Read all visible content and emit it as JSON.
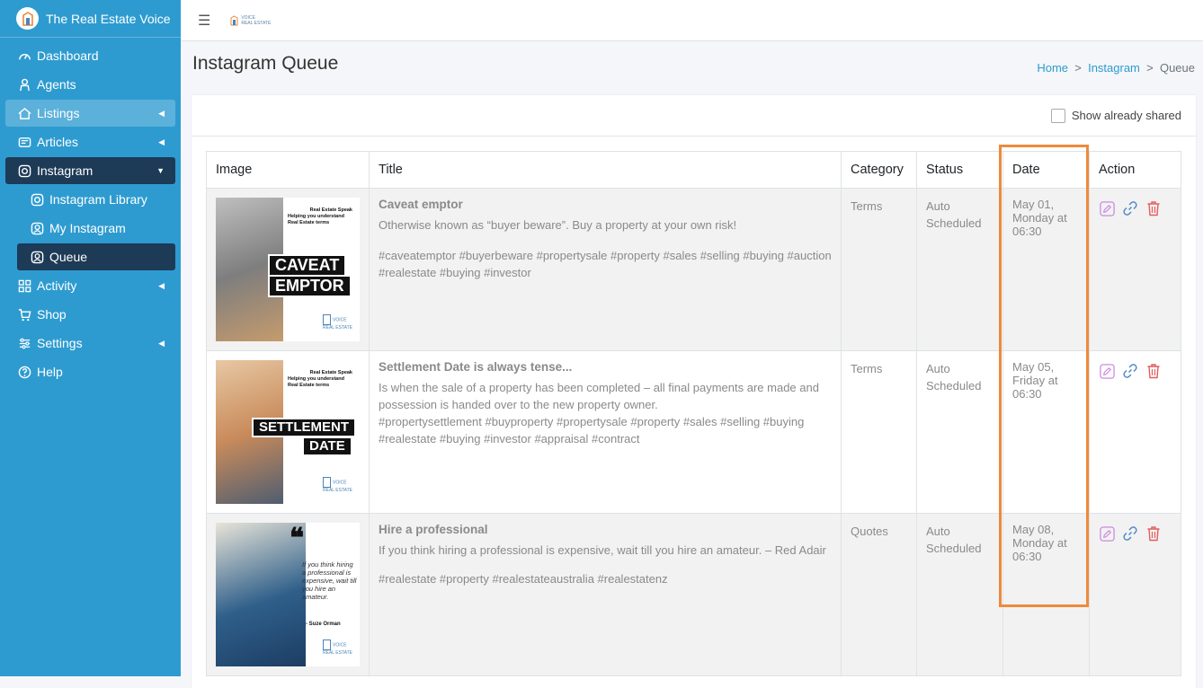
{
  "app": {
    "title": "The Real Estate Voice"
  },
  "sidebar": {
    "items": [
      {
        "label": "Dashboard",
        "icon": "dashboard-icon"
      },
      {
        "label": "Agents",
        "icon": "agents-icon"
      },
      {
        "label": "Listings",
        "icon": "listings-icon"
      },
      {
        "label": "Articles",
        "icon": "articles-icon"
      },
      {
        "label": "Instagram",
        "icon": "instagram-icon"
      },
      {
        "label": "Instagram Library",
        "icon": "instagram-icon"
      },
      {
        "label": "My Instagram",
        "icon": "my-instagram-icon"
      },
      {
        "label": "Queue",
        "icon": "queue-icon"
      },
      {
        "label": "Activity",
        "icon": "activity-icon"
      },
      {
        "label": "Shop",
        "icon": "cart-icon"
      },
      {
        "label": "Settings",
        "icon": "settings-icon"
      },
      {
        "label": "Help",
        "icon": "help-icon"
      }
    ]
  },
  "topbar": {
    "logo_line1": "VOICE",
    "logo_line2": "REAL ESTATE"
  },
  "page": {
    "title": "Instagram Queue"
  },
  "breadcrumb": {
    "home": "Home",
    "sep": ">",
    "instagram": "Instagram",
    "current": "Queue"
  },
  "filter": {
    "show_shared_label": "Show already shared",
    "show_shared_checked": false
  },
  "table": {
    "headers": [
      "Image",
      "Title",
      "Category",
      "Status",
      "Date",
      "Action"
    ],
    "rows": [
      {
        "image": {
          "speak": "Real Estate Speak",
          "help": "Helping you understand Real Estate terms",
          "big1": "CAVEAT",
          "big2": "EMPTOR",
          "brand1": "VOICE",
          "brand2": "REAL ESTATE"
        },
        "title": "Caveat emptor",
        "desc": "Otherwise known as “buyer beware”. Buy a property at your own risk!",
        "tags": "#caveatemptor #buyerbeware #propertysale #property #sales #selling #buying #auction #realestate #buying #investor",
        "category": "Terms",
        "status": "Auto Scheduled",
        "date": "May 01, Monday at 06:30"
      },
      {
        "image": {
          "speak": "Real Estate Speak",
          "help": "Helping you understand Real Estate terms",
          "big1": "SETTLEMENT",
          "big2": "DATE",
          "brand1": "VOICE",
          "brand2": "REAL ESTATE"
        },
        "title": "Settlement Date is always tense...",
        "desc": "Is when the sale of a property has been completed – all final payments are made and possession is handed over to the new property owner.",
        "tags": "#propertysettlement #buyproperty #propertysale #property #sales #selling #buying #realestate #buying #investor #appraisal #contract",
        "category": "Terms",
        "status": "Auto Scheduled",
        "date": "May 05, Friday at 06:30"
      },
      {
        "image": {
          "quote_mark": "❝",
          "quote": "If you think hiring a professional is expensive, wait till you hire an amateur.",
          "author": "- Suze Orman",
          "brand1": "VOICE",
          "brand2": "REAL ESTATE"
        },
        "title": "Hire a professional",
        "desc": "If you think hiring a professional is expensive, wait till you hire an amateur. – Red Adair",
        "tags": "#realestate #property #realestateaustralia #realestatenz",
        "category": "Quotes",
        "status": "Auto Scheduled",
        "date": "May 08, Monday at 06:30"
      }
    ]
  },
  "colors": {
    "sidebar": "#2e9bd0",
    "active": "#1d3a56",
    "highlight": "#ee8a3b",
    "edit": "#c77ddb",
    "link": "#4a86c9",
    "delete": "#e35d5d"
  }
}
